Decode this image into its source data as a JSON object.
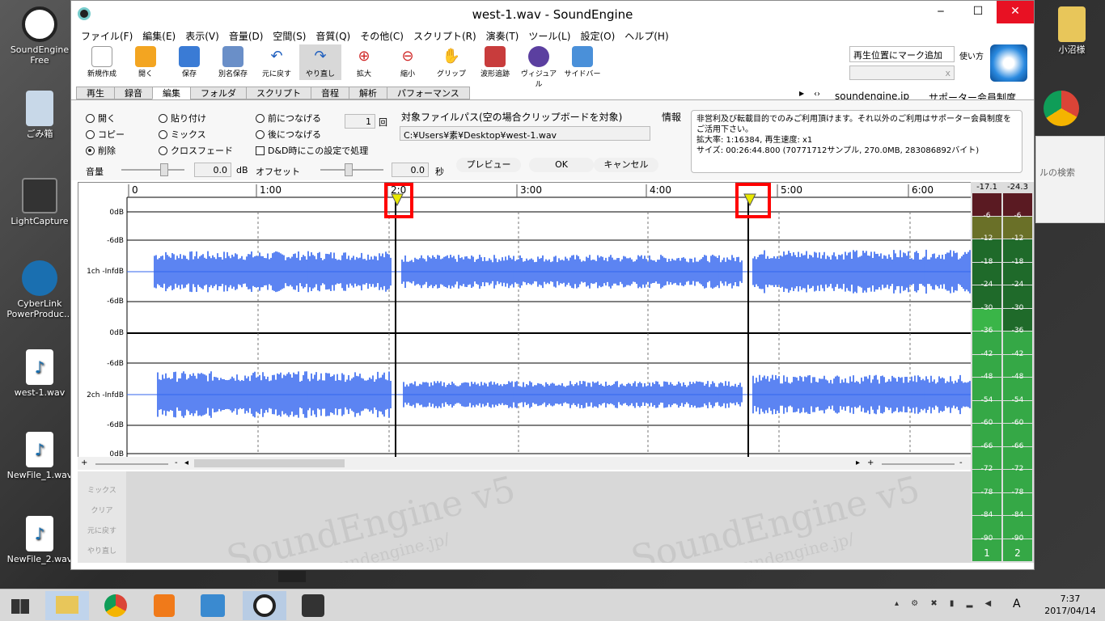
{
  "desktop": {
    "icons": [
      {
        "label": "SoundEngine Free",
        "color": "#ffffff"
      },
      {
        "label": "ごみ箱",
        "color": "#c8d8e8"
      },
      {
        "label": "LightCapture",
        "color": "#333333"
      },
      {
        "label": "CyberLink PowerProduc...",
        "color": "#1a6fb0"
      },
      {
        "label": "west-1.wav",
        "color": "#ffffff"
      },
      {
        "label": "NewFile_1.wav",
        "color": "#ffffff"
      },
      {
        "label": "NewFile_2.wav",
        "color": "#ffffff"
      }
    ],
    "right_icon_label": "小沼様"
  },
  "window": {
    "title": "west-1.wav - SoundEngine",
    "menu": [
      "ファイル(F)",
      "編集(E)",
      "表示(V)",
      "音量(D)",
      "空間(S)",
      "音質(Q)",
      "その他(C)",
      "スクリプト(R)",
      "演奏(T)",
      "ツール(L)",
      "設定(O)",
      "ヘルプ(H)"
    ],
    "toolbar": [
      {
        "label": "新規作成",
        "icon": "new-file-icon",
        "color": "#ffffff"
      },
      {
        "label": "開く",
        "icon": "folder-icon",
        "color": "#f3a521"
      },
      {
        "label": "保存",
        "icon": "save-icon",
        "color": "#3a7bd5"
      },
      {
        "label": "別名保存",
        "icon": "save-as-icon",
        "color": "#6a8fc8"
      },
      {
        "label": "元に戻す",
        "icon": "undo-icon",
        "color": "#1f5fbf"
      },
      {
        "label": "やり直し",
        "icon": "redo-icon",
        "color": "#1f5fbf"
      },
      {
        "label": "拡大",
        "icon": "zoom-in-icon",
        "color": "#d02a2a"
      },
      {
        "label": "縮小",
        "icon": "zoom-out-icon",
        "color": "#d02a2a"
      },
      {
        "label": "グリップ",
        "icon": "hand-icon",
        "color": "#e8e8e8"
      },
      {
        "label": "波形追跡",
        "icon": "wave-track-icon",
        "color": "#c83c3c"
      },
      {
        "label": "ヴィジュアル",
        "icon": "visual-icon",
        "color": "#5b3fa0"
      },
      {
        "label": "サイドバー",
        "icon": "sidebar-icon",
        "color": "#4a90d9"
      }
    ],
    "marker_button": "再生位置にマーク追加",
    "usage_label": "使い方",
    "close_x": "x",
    "tabs": [
      "再生",
      "録音",
      "編集",
      "フォルダ",
      "スクリプト",
      "音程",
      "解析",
      "パフォーマンス"
    ],
    "active_tab": "編集",
    "site_link": "soundengine.jp",
    "supporter": "サポーター会員制度",
    "edit": {
      "radios1": [
        "開く",
        "コピー",
        "削除"
      ],
      "radios2": [
        "貼り付け",
        "ミックス",
        "クロスフェード"
      ],
      "radios3": [
        "前につなげる",
        "後につなげる"
      ],
      "checkbox": "D&D時にこの設定で処理",
      "count_value": "1",
      "count_unit": "回",
      "path_label": "対象ファイルパス(空の場合クリップボードを対象)",
      "path_value": "C:¥Users¥素¥Desktop¥west-1.wav",
      "volume_label": "音量",
      "volume_value": "0.0",
      "volume_unit": "dB",
      "offset_label": "オフセット",
      "offset_value": "0.0",
      "offset_unit": "秒",
      "preview": "プレビュー",
      "ok": "OK",
      "cancel": "キャンセル"
    },
    "info_label": "情報",
    "info": [
      "非営利及び転載目的でのみご利用頂けます。それ以外のご利用はサポーター会員制度を",
      "ご活用下さい。",
      "拡大率: 1:16384, 再生速度: x1",
      "サイズ: 00:26:44.800 (70771712サンプル, 270.0MB, 283086892バイト)"
    ],
    "timeline": [
      "0",
      "1:00",
      "2:0",
      "3:00",
      "4:00",
      "5:00",
      "6:00"
    ],
    "ch1_labels": [
      "0dB",
      "-6dB",
      "1ch -InfdB",
      "-6dB",
      "0dB"
    ],
    "ch2_labels": [
      "-6dB",
      "2ch -InfdB",
      "-6dB",
      "0dB"
    ],
    "wave_color": "#3366ee",
    "vu": {
      "peak1": "-17.1",
      "peak2": "-24.3",
      "scale": [
        "-6",
        "-12",
        "-18",
        "-24",
        "-30",
        "-36",
        "-42",
        "-48",
        "-54",
        "-60",
        "-66",
        "-72",
        "-78",
        "-84",
        "-90"
      ],
      "ch_labels": [
        "1",
        "2"
      ],
      "level1": 0.66,
      "level2": 0.61
    },
    "side_buttons": [
      "ミックス",
      "クリア",
      "元に戻す",
      "やり直し"
    ],
    "watermark": "SoundEngine v5",
    "watermark2": "soundengine.jp/"
  },
  "right_panel": {
    "search": "ルの検索"
  },
  "taskbar": {
    "time": "7:37",
    "date": "2017/04/14",
    "ime": "A"
  }
}
